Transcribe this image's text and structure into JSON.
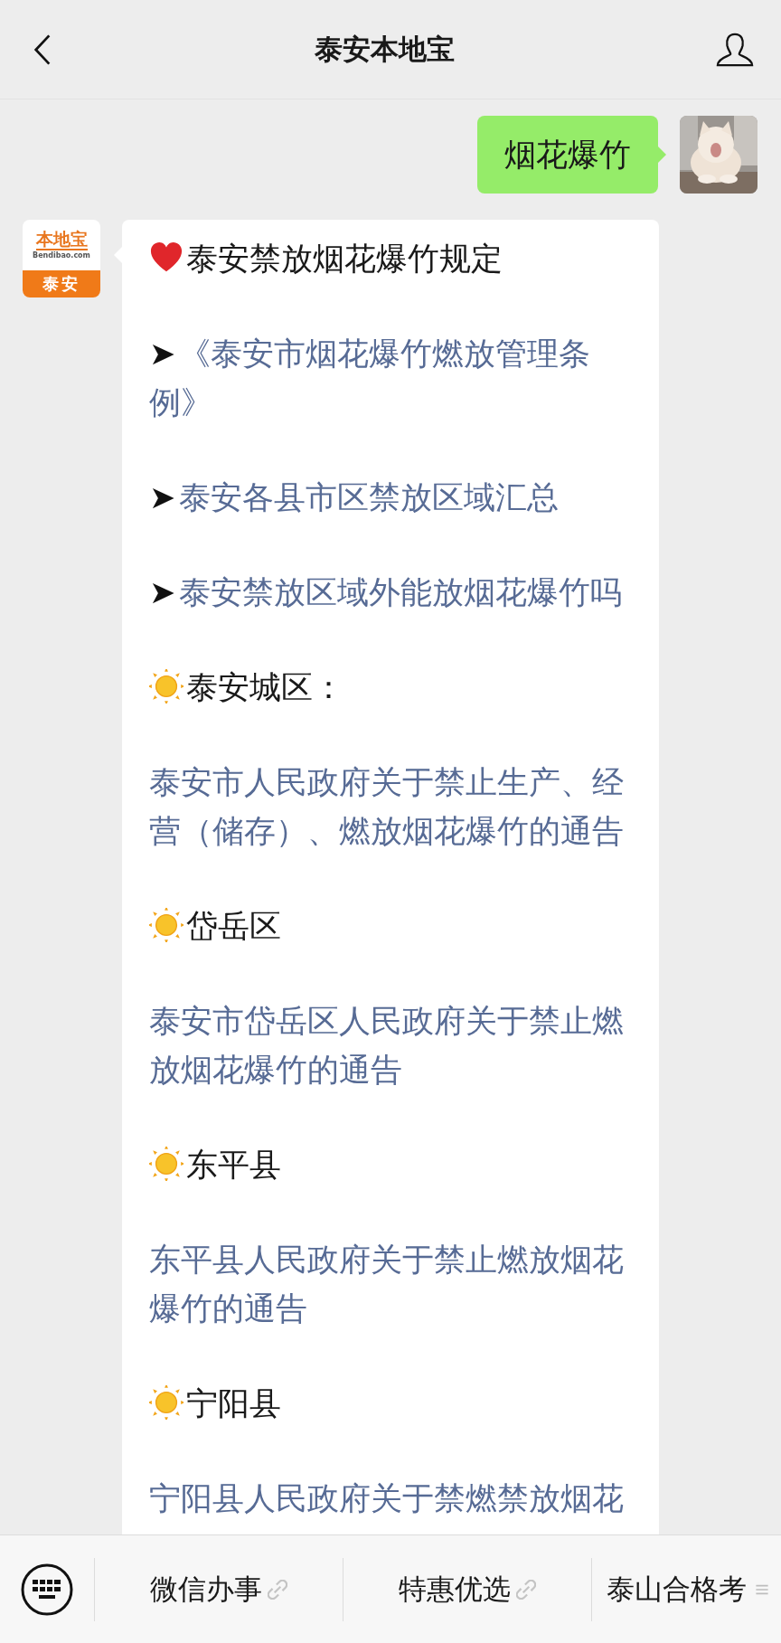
{
  "header": {
    "title": "泰安本地宝"
  },
  "messages": [
    {
      "sent": true,
      "text": "烟花爆竹"
    },
    {
      "sent": false,
      "avatar": {
        "kind": "logo",
        "brand": "本地宝",
        "site": "Bendibao.com",
        "city": "泰安"
      },
      "blocks": [
        {
          "kind": "title",
          "text": "泰安禁放烟花爆竹规定"
        },
        {
          "kind": "link",
          "marker": "➤",
          "text": "《泰安市烟花爆竹燃放管理条例》"
        },
        {
          "kind": "link",
          "marker": "➤",
          "text": "泰安各县市区禁放区域汇总"
        },
        {
          "kind": "link",
          "marker": "➤",
          "text": "泰安禁放区域外能放烟花爆竹吗"
        },
        {
          "kind": "section",
          "text": "泰安城区："
        },
        {
          "kind": "paragraph",
          "text": "泰安市人民政府关于禁止生产、经营（储存）、燃放烟花爆竹的通告"
        },
        {
          "kind": "section",
          "text": "岱岳区"
        },
        {
          "kind": "paragraph",
          "text": "泰安市岱岳区人民政府关于禁止燃放烟花爆竹的通告"
        },
        {
          "kind": "section",
          "text": "东平县"
        },
        {
          "kind": "paragraph",
          "text": "东平县人民政府关于禁止燃放烟花爆竹的通告"
        },
        {
          "kind": "section",
          "text": "宁阳县"
        },
        {
          "kind": "paragraph",
          "text": "宁阳县人民政府关于禁燃禁放烟花"
        }
      ]
    }
  ],
  "menu": [
    {
      "label": "微信办事",
      "kind": "link"
    },
    {
      "label": "特惠优选",
      "kind": "link"
    },
    {
      "label": "泰山合格考",
      "kind": "submenu"
    }
  ]
}
